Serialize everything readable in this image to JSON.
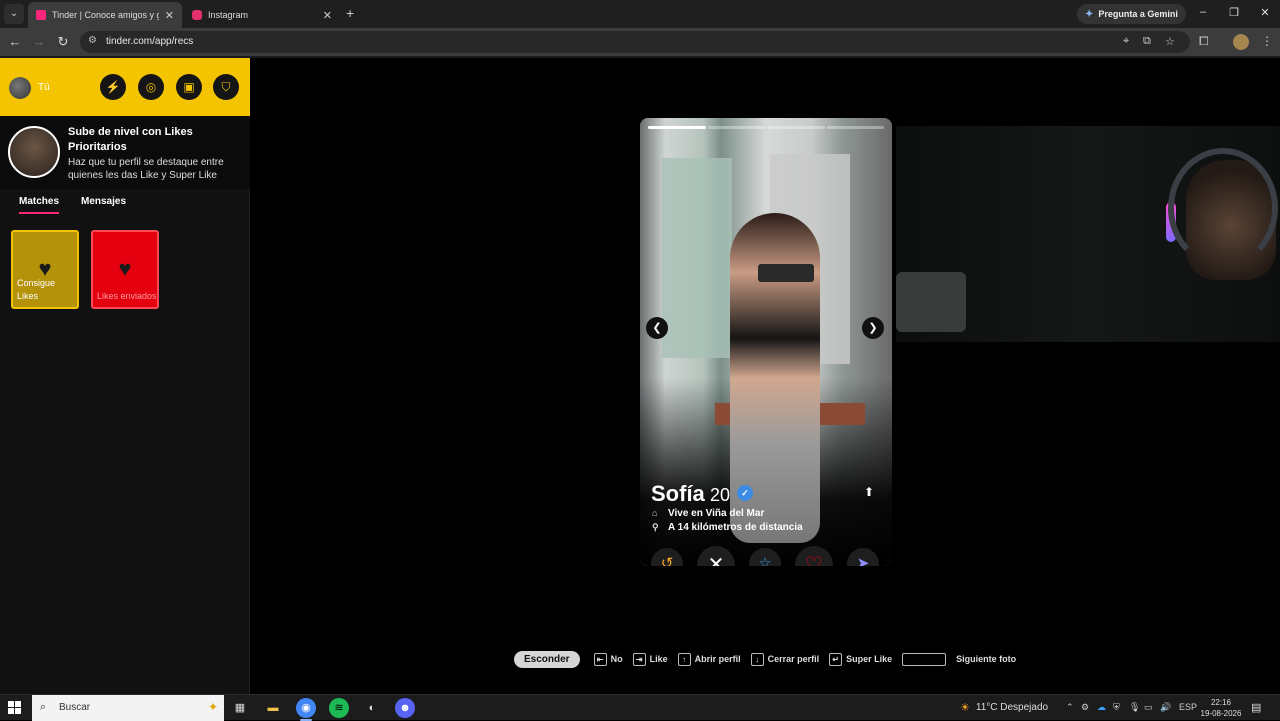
{
  "browser": {
    "tabs": [
      {
        "title": "Tinder | Conoce amigos y gente",
        "favicon_color": "#fd267a",
        "active": true
      },
      {
        "title": "Instagram",
        "favicon_color": "#e1306c",
        "active": false
      }
    ],
    "gemini_label": "Pregunta a Gemini",
    "url": "tinder.com/app/recs"
  },
  "sidebar": {
    "user_label": "Tú",
    "header_buttons": [
      "lightning-icon",
      "compass-icon",
      "briefcase-icon",
      "shield-icon"
    ],
    "promo": {
      "title": "Sube de nivel con Likes Prioritarios",
      "description": "Haz que tu perfil se destaque entre quienes les das Like y Super Like"
    },
    "tabs": [
      {
        "label": "Matches",
        "active": true
      },
      {
        "label": "Mensajes",
        "active": false
      }
    ],
    "cards": [
      {
        "label": "Consigue Likes",
        "icon": "likes-stack-icon",
        "color": "#b4920a"
      },
      {
        "label": "Likes enviados",
        "icon": "heart-icon",
        "color": "#e5000f"
      }
    ]
  },
  "profile": {
    "name": "Sofía",
    "age": "20",
    "verified": true,
    "lives_in": "Vive en Viña del Mar",
    "distance": "A 14 kilómetros de distancia",
    "photo_count": 4,
    "current_photo": 1,
    "actions": [
      "rewind-icon",
      "nope-icon",
      "superlike-icon",
      "like-icon",
      "boost-icon"
    ]
  },
  "shortcuts": {
    "hide_button": "Esconder",
    "items": [
      {
        "key": "⇤",
        "label": "No"
      },
      {
        "key": "⇥",
        "label": "Like"
      },
      {
        "key": "↑",
        "label": "Abrir perfil"
      },
      {
        "key": "↓",
        "label": "Cerrar perfil"
      },
      {
        "key": "↵",
        "label": "Super Like"
      }
    ],
    "space_label": "Siguiente foto"
  },
  "taskbar": {
    "search_placeholder": "Buscar",
    "weather": "11°C  Despejado",
    "language": "ESP",
    "time": "22:16",
    "date": "19-08-2026"
  },
  "colors": {
    "tinder_gold": "#f4c400",
    "tinder_pink": "#fd267a",
    "like_red": "#e5000f",
    "verified_blue": "#3c8be3"
  }
}
